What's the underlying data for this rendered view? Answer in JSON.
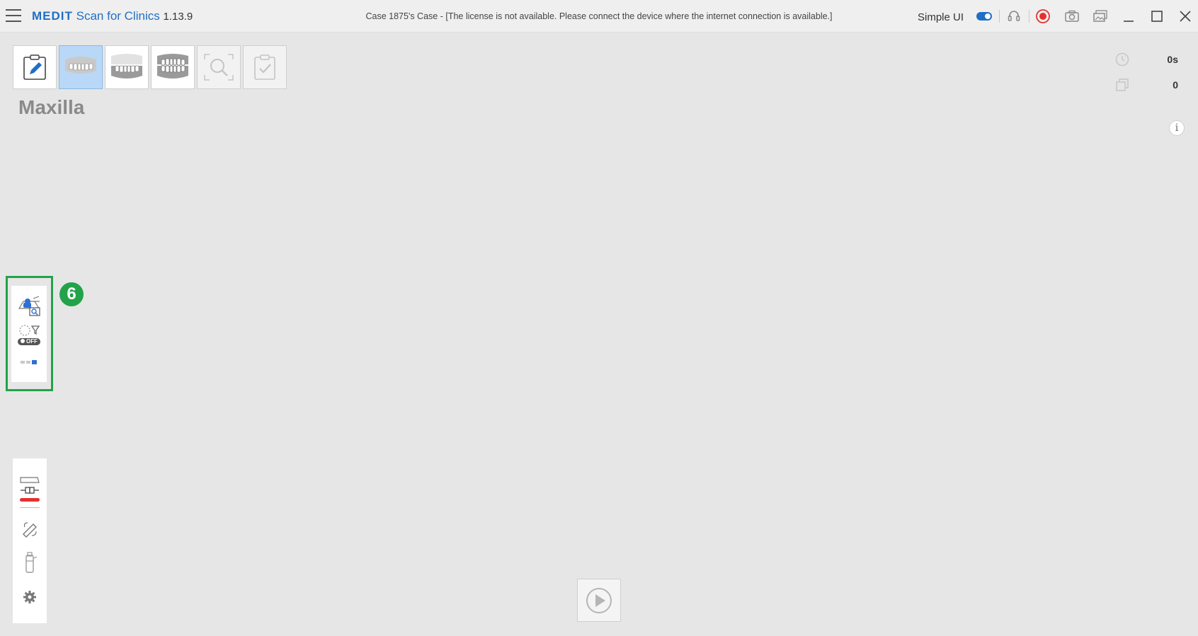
{
  "titlebar": {
    "brand": "MEDIT",
    "product": "Scan for Clinics",
    "version": "1.13.9",
    "case_title": "Case 1875's Case - [The license is not available. Please connect the device where the internet connection is available.]",
    "simple_ui_label": "Simple UI",
    "simple_ui_enabled": true,
    "icons": [
      "menu-icon",
      "headset-icon",
      "record-icon",
      "camera-icon",
      "gallery-icon",
      "minimize-icon",
      "maximize-icon",
      "close-icon"
    ]
  },
  "stages": [
    {
      "name": "case-form",
      "icon": "clipboard-edit-icon",
      "state": "normal"
    },
    {
      "name": "maxilla",
      "icon": "maxilla-icon",
      "state": "active"
    },
    {
      "name": "mandible",
      "icon": "mandible-icon",
      "state": "normal"
    },
    {
      "name": "occlusion",
      "icon": "occlusion-icon",
      "state": "normal"
    },
    {
      "name": "analysis",
      "icon": "magnify-scan-icon",
      "state": "disabled"
    },
    {
      "name": "complete",
      "icon": "clipboard-check-icon",
      "state": "disabled"
    }
  ],
  "stage_title": "Maxilla",
  "stats": {
    "time_value": "0s",
    "count_value": "0"
  },
  "side_panel": {
    "step_number": "6",
    "toggle_label": "OFF"
  },
  "colors": {
    "accent": "#1f6fc5",
    "highlight": "#22a34a",
    "record": "#e53030",
    "background": "#e6e6e6"
  }
}
